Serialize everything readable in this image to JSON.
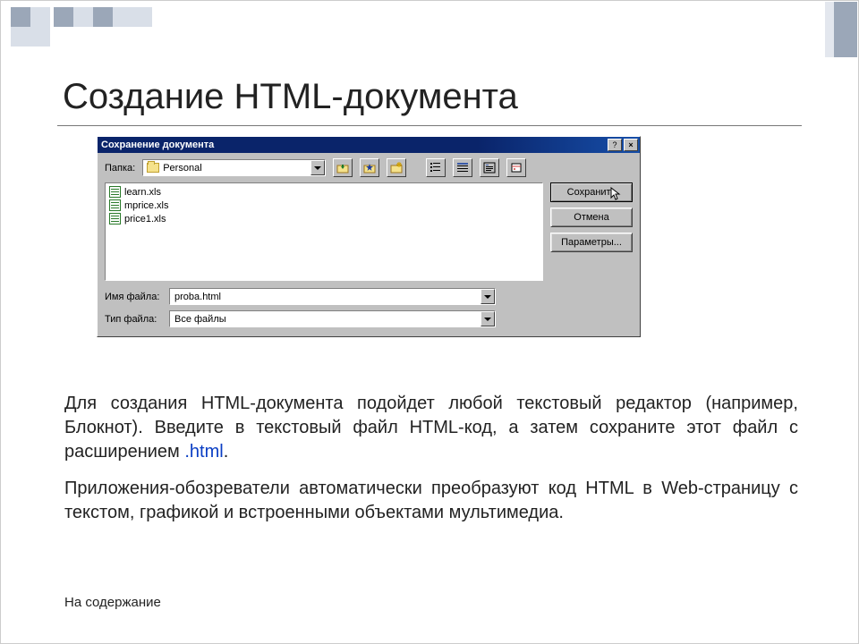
{
  "page": {
    "title": "Создание HTML-документа",
    "toc_link": "На содержание"
  },
  "dialog": {
    "title": "Сохранение документа",
    "folder_label": "Папка:",
    "folder_value": "Personal",
    "files": [
      "learn.xls",
      "mprice.xls",
      "price1.xls"
    ],
    "filename_label": "Имя файла:",
    "filename_value": "proba.html",
    "filetype_label": "Тип файла:",
    "filetype_value": "Все файлы",
    "buttons": {
      "save": "Сохранить",
      "cancel": "Отмена",
      "params": "Параметры..."
    },
    "win_help": "?",
    "win_close": "×"
  },
  "body": {
    "p1a": "Для создания HTML-документа подойдет любой текстовый редактор (например, Блокнот). Введите в текстовый файл HTML-код, а затем сохраните этот файл с расширением ",
    "p1b": ".html",
    "p1c": ".",
    "p2": "Приложения-обозреватели автоматически преобразуют код HTML в Web-страницу с текстом, графикой и встроенными объектами мультимедиа."
  }
}
